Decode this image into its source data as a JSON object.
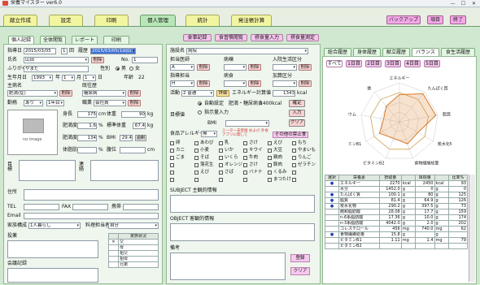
{
  "window": {
    "title": "栄養マイスター ver6.0",
    "min": "—",
    "max": "☐",
    "close": "✕"
  },
  "nav_tabs": [
    "献立作成",
    "設定",
    "印刷",
    "個人管理",
    "統計",
    "発注帳計算"
  ],
  "active_nav": 3,
  "top_buttons": {
    "backup": "バックアップ",
    "project": "項目",
    "end": "終了"
  },
  "sub_tabs": [
    "個人記録",
    "全体閲覧",
    "レポート",
    "印刷"
  ],
  "action_buttons": [
    "食事記録",
    "食習慣閲覧",
    "摂食量入力",
    "摂食量測定"
  ],
  "right_tabs": [
    "総合履歴",
    "身体履歴",
    "献立履歴",
    "バランス",
    "食生活履歴"
  ],
  "active_right_tab": 3,
  "personal": {
    "record_date_label": "指導日",
    "record_date": "2015/03/05",
    "count": "1",
    "count_suffix": "回",
    "history_label": "履歴",
    "history_value": "2015/03/05(1回目)",
    "name_label": "氏名",
    "name": "山田",
    "delete": "削除",
    "no_label": "No.",
    "no_value": "1",
    "kana_label": "ふりがな",
    "kana": "やまだ",
    "gender_label": "性別",
    "male": "男",
    "female": "女",
    "birth_label": "生年月日",
    "birth_year": "1993",
    "year_unit": "年",
    "birth_month": "1",
    "month_unit": "月",
    "birth_day": "1",
    "day_unit": "日",
    "age_label": "年齢",
    "age": "22",
    "disease_label": "主病名",
    "disease": "肥満(症)",
    "disease_delete": "削除",
    "complication_label": "既往歴",
    "complication": "糖尿病",
    "complication_delete": "削除",
    "occupation_label": "勤務",
    "occupation": "あり",
    "occupation_time": "1年目",
    "position_label": "職業",
    "position": "会社員",
    "photo_text": "no image",
    "height_label": "身長",
    "height": "175",
    "height_unit": "cm",
    "weight_label": "体重",
    "weight": "90",
    "weight_unit": "kg",
    "fat_label": "肥満度",
    "fat": "1.6",
    "fat_unit": "%",
    "std_weight_label": "標準体重",
    "std_weight": "67.4",
    "std_weight_unit": "kg",
    "obesity_label": "肥満度",
    "obesity": "134",
    "obesity_unit": "%",
    "bmi_label": "BMI",
    "bmi": "29.4",
    "bmi_status": "過剰",
    "body_fat_label": "体脂肪",
    "body_fat": "",
    "body_fat_unit": "%",
    "waist_label": "腹位",
    "waist": "",
    "waist_unit": "cm",
    "goal_label": "目標",
    "content_label": "連絡",
    "address_label": "住所",
    "tel_label": "TEL",
    "fax_label": "FAX",
    "mobile_label": "携帯",
    "email_label": "Email",
    "family_label": "家族構成",
    "family_value": "1人暮らし",
    "cook_label": "料理担当者",
    "cook_value": "自分",
    "memo_label": "投薬",
    "notes_label": "会議記録",
    "allergy_header": "家族状況",
    "allergy_rows": [
      "父",
      "母",
      "祖父",
      "祖母",
      "兄弟"
    ]
  },
  "middle": {
    "institution_label": "施設名",
    "institution": "病院",
    "clinic_label": "担当医師",
    "clinic": "A",
    "clinic_delete": "削除",
    "ward_label": "病棟",
    "ward": "",
    "ward_delete": "削除",
    "admit_label": "入院生活区分",
    "admit": "",
    "admit_delete": "削除",
    "dietitian_label": "指導担当",
    "dietitian": "H",
    "dietitian_delete": "削除",
    "meal_label": "病食",
    "meal": "",
    "meal_delete": "削除",
    "addition_label": "加算区分",
    "addition": "",
    "addition_delete": "削除",
    "activity_label": "活動",
    "activity": "2 普通",
    "activity_detail": "詳細",
    "energy_label": "エネルギー計算値",
    "energy": "1343",
    "energy_unit": "kcal",
    "auto_set": "自動設定",
    "bmr_label": "肥満・糖尿病食",
    "bmr": "1400kcal",
    "confirm": "確定",
    "manual": "指示量入力",
    "input": "入力",
    "target_label": "目標値",
    "bmi2": "BMI",
    "clear": "クリア",
    "allergy_label": "食品アレルギー",
    "allergy_value": "無",
    "hint": "ミーター未登録 および 外食アプリに関して",
    "other_allergy": "その他の禁止食",
    "foods": [
      "卵",
      "あわび",
      "乳",
      "さけ",
      "えび",
      "もち",
      "カニ",
      "小麦",
      "いか",
      "キウイ",
      "大豆",
      "やまいも",
      "ごま",
      "そば",
      "いくら",
      "牛肉",
      "鶏肉",
      "りんご",
      "",
      "落花生",
      "オレンジ",
      "さけ",
      "豚肉",
      "ゼラチン",
      "",
      "えび",
      "さば",
      "バナナ",
      "くるみ",
      "",
      "",
      "",
      "",
      "",
      "まつたけ",
      ""
    ],
    "subject_label": "SUBJECT 主観的情報",
    "object_label": "OBJECT 客観的情報",
    "remarks_label": "備考",
    "save": "登録",
    "clear2": "クリア"
  },
  "right": {
    "period_buttons": [
      "すべて",
      "1日目",
      "2日目",
      "3日目",
      "4日目",
      "5日目"
    ],
    "radar_labels": [
      "エネルギー",
      "たんぱく質",
      "脂質",
      "炭水化物",
      "食物繊維総量",
      "ビタミンB2",
      "ビタミンB1",
      "カルシウム",
      "鉄"
    ],
    "table_headers": [
      "選択",
      "栄養素",
      "摂取量",
      "",
      "目標量",
      "",
      "比率%"
    ],
    "rows": [
      [
        "●",
        "エネルギー",
        "2270",
        "kcal",
        "2450",
        "kcal",
        "93"
      ],
      [
        "",
        "水分",
        "1452.0",
        "g",
        "0",
        "g",
        "0"
      ],
      [
        "●",
        "たんぱく質",
        "100.1",
        "g",
        "80",
        "g",
        "125"
      ],
      [
        "●",
        "脂質",
        "81.4",
        "g",
        "64.9",
        "g",
        "126"
      ],
      [
        "●",
        "炭水化物",
        "290.2",
        "g",
        "397.5",
        "g",
        "73"
      ],
      [
        "",
        "飽和脂肪酸",
        "28.08",
        "g",
        "17.7",
        "g",
        "159"
      ],
      [
        "",
        "n-6系脂肪酸",
        "17.36",
        "g",
        "10.0",
        "g",
        "174"
      ],
      [
        "",
        "n-3系脂肪酸",
        "4042.0",
        "g",
        "2.0",
        "g",
        "202"
      ],
      [
        "",
        "コレステロール",
        "456",
        "mg",
        "740.0",
        "mg",
        "62"
      ],
      [
        "●",
        "食物繊維総量",
        "15.8",
        "g",
        "",
        "g",
        ""
      ],
      [
        "",
        "ビタミンB1",
        "1.11",
        "mg",
        "1.4",
        "mg",
        "79"
      ],
      [
        "",
        "ビタミンB2",
        "",
        "",
        "",
        "",
        ""
      ]
    ]
  }
}
